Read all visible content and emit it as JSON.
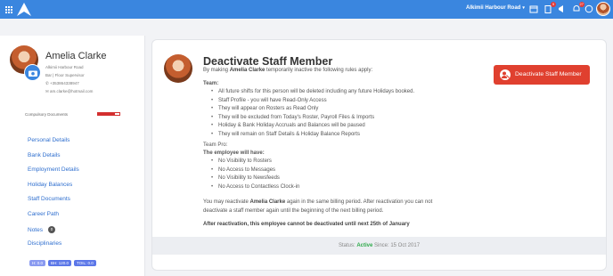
{
  "topbar": {
    "location": "Alkimii Harbour Road",
    "badges": {
      "messages": "9",
      "notifications": "27"
    }
  },
  "sidebar": {
    "name": "Amelia Clarke",
    "site": "Alkimii Harbour Road",
    "role": "Bar | Floor Supervisor",
    "phone": "+353864338947",
    "email": "am.clarke@hotmail.com",
    "compulsory_label": "Compulsory Documents",
    "compulsory_progress": 0.8,
    "nav": [
      {
        "label": "Personal Details"
      },
      {
        "label": "Bank Details"
      },
      {
        "label": "Employment Details"
      },
      {
        "label": "Holiday Balances"
      },
      {
        "label": "Staff Documents"
      },
      {
        "label": "Career Path"
      },
      {
        "label": "Notes",
        "badge": "0"
      },
      {
        "label": "Disciplinaries"
      }
    ],
    "chips": [
      "H: 0.0",
      "BH: 120.0",
      "TOIL: 0.0"
    ]
  },
  "main": {
    "title": "Deactivate Staff Member",
    "subtitle_pre": "By making ",
    "subtitle_name": "Amelia Clarke",
    "subtitle_post": " temporarily inactive the following rules apply:",
    "button_label": "Deactivate Staff Member",
    "team_heading": "Team:",
    "team_rules": [
      "All future shifts for this person will be deleted including any future Holidays booked.",
      "Staff Profile - you will have Read-Only Access",
      "They will appear on Rosters as Read Only",
      "They will be excluded from Today's Roster, Payroll Files & Imports",
      "Holiday & Bank Holiday Accruals and Balances will be paused",
      "They will remain on Staff Details & Holiday Balance Reports"
    ],
    "team_pro_heading": "Team Pro:",
    "employee_heading": "The employee will have:",
    "employee_rules": [
      "No Visibility to Rosters",
      "No Access to Messages",
      "No Visibility to Newsfeeds",
      "No Access to Contactless Clock-in"
    ],
    "reactivate_pre": "You may reactivate ",
    "reactivate_name": "Amelia Clarke",
    "reactivate_post": " again in the same billing period. After reactivation you can not deactivate a staff member again until the beginning of the next billing period.",
    "after_note": "After reactivation, this employee cannot be deactivated until next 25th of January",
    "status_label": "Status: ",
    "status_value": "Active",
    "status_since": " Since: 15 Oct 2017"
  },
  "colors": {
    "topbar": "#3a86df",
    "danger_button": "#e0402f",
    "active_status": "#2eaa4a",
    "nav_link": "#2f6fcf"
  },
  "icons": [
    "apps-grid-icon",
    "alkimii-logo",
    "calendar-icon",
    "clipboard-icon",
    "megaphone-icon",
    "bell-icon",
    "chat-icon",
    "camera-icon",
    "phone-icon",
    "mail-icon",
    "deactivate-user-icon"
  ]
}
